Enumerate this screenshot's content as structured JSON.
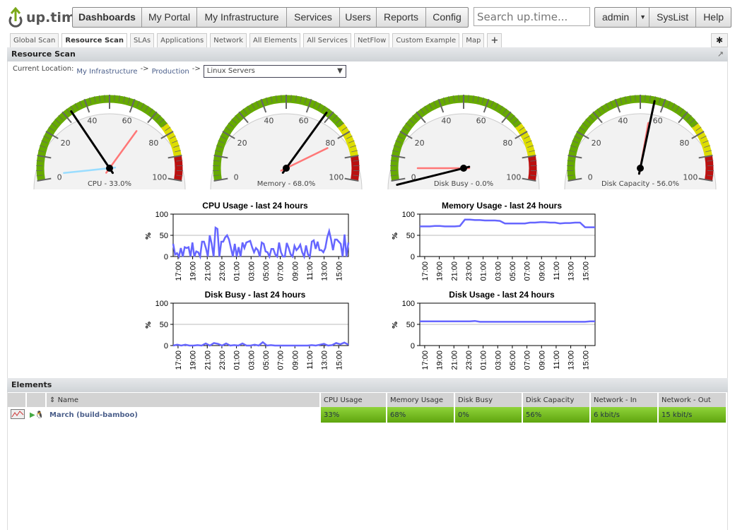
{
  "app": {
    "logo": "up.time"
  },
  "nav": {
    "items": [
      "Dashboards",
      "My Portal",
      "My Infrastructure",
      "Services",
      "Users",
      "Reports",
      "Config"
    ],
    "search_placeholder": "Search up.time...",
    "user": "admin",
    "syslist": "SysList",
    "help": "Help"
  },
  "tabs": [
    "Global Scan",
    "Resource Scan",
    "SLAs",
    "Applications",
    "Network",
    "All Elements",
    "All Services",
    "NetFlow",
    "Custom Example",
    "Map",
    "+"
  ],
  "panel": {
    "title": "Resource Scan",
    "location_label": "Current Location:",
    "crumbs": [
      "My Infrastructure",
      "Production"
    ],
    "sep": "->",
    "selected": "Linux Servers"
  },
  "gauges": [
    {
      "label": "CPU - 33.0%",
      "value": 33,
      "max": 68,
      "min": 2
    },
    {
      "label": "Memory - 68.0%",
      "value": 68,
      "max": 82,
      "min": null
    },
    {
      "label": "Disk Busy - 0.0%",
      "value": -2,
      "max": 5,
      "min": null
    },
    {
      "label": "Disk Capacity - 56.0%",
      "value": 56,
      "max": 55,
      "min": null
    }
  ],
  "gauge_ticks": [
    "0",
    "20",
    "40",
    "60",
    "80",
    "100"
  ],
  "chart_data": [
    {
      "type": "line",
      "title": "CPU Usage - last 24 hours",
      "ylabel": "%",
      "ylim": [
        0,
        100
      ],
      "yticks": [
        "0",
        "50",
        "100"
      ],
      "xticks": [
        "17:00",
        "19:00",
        "21:00",
        "23:00",
        "01:00",
        "03:00",
        "05:00",
        "07:00",
        "09:00",
        "11:00",
        "13:00",
        "15:00"
      ],
      "values": [
        30,
        5,
        8,
        0,
        20,
        0,
        22,
        20,
        22,
        0,
        33,
        0,
        12,
        10,
        0,
        35,
        35,
        20,
        0,
        50,
        30,
        0,
        68,
        65,
        0,
        35,
        35,
        45,
        50,
        40,
        20,
        0,
        30,
        0,
        22,
        0,
        33,
        20,
        33,
        35,
        37,
        22,
        10,
        20,
        15,
        0,
        33,
        30,
        12,
        10,
        0,
        18,
        18,
        5,
        0,
        33,
        10,
        0,
        0,
        32,
        20,
        5,
        0,
        25,
        15,
        20,
        28,
        10,
        0,
        26,
        5,
        0,
        35,
        38,
        18,
        35,
        15,
        15,
        10,
        20,
        45,
        60,
        40,
        15,
        40,
        40,
        35,
        30,
        0,
        52,
        0,
        33
      ]
    },
    {
      "type": "line",
      "title": "Memory Usage - last 24 hours",
      "ylabel": "%",
      "ylim": [
        0,
        100
      ],
      "yticks": [
        "0",
        "50",
        "100"
      ],
      "xticks": [
        "17:00",
        "19:00",
        "21:00",
        "23:00",
        "01:00",
        "03:00",
        "05:00",
        "07:00",
        "09:00",
        "11:00",
        "13:00",
        "15:00"
      ],
      "values": [
        71,
        71,
        71,
        72,
        72,
        71,
        71,
        71,
        72,
        87,
        87,
        86,
        86,
        85,
        85,
        85,
        84,
        78,
        78,
        78,
        78,
        78,
        80,
        80,
        81,
        81,
        80,
        80,
        78,
        79,
        79,
        80,
        80,
        69,
        69,
        69
      ]
    },
    {
      "type": "line",
      "title": "Disk Busy - last 24 hours",
      "ylabel": "%",
      "ylim": [
        0,
        100
      ],
      "yticks": [
        "0",
        "50",
        "100"
      ],
      "xticks": [
        "17:00",
        "19:00",
        "21:00",
        "23:00",
        "01:00",
        "03:00",
        "05:00",
        "07:00",
        "09:00",
        "11:00",
        "13:00",
        "15:00"
      ],
      "values": [
        0,
        2,
        0,
        2,
        0,
        0,
        1,
        0,
        5,
        0,
        6,
        4,
        0,
        5,
        0,
        1,
        0,
        5,
        0,
        0,
        2,
        0,
        8,
        0,
        1,
        0,
        0,
        0,
        0,
        0,
        0,
        0,
        0,
        0,
        1,
        0,
        2,
        4,
        0,
        1,
        6,
        3,
        7,
        2
      ]
    },
    {
      "type": "line",
      "title": "Disk Usage - last 24 hours",
      "ylabel": "%",
      "ylim": [
        0,
        100
      ],
      "yticks": [
        "0",
        "50",
        "100"
      ],
      "xticks": [
        "17:00",
        "19:00",
        "21:00",
        "23:00",
        "01:00",
        "03:00",
        "05:00",
        "07:00",
        "09:00",
        "11:00",
        "13:00",
        "15:00"
      ],
      "values": [
        57,
        57,
        57,
        57,
        57,
        57,
        57,
        57,
        57,
        57,
        57,
        58,
        56,
        56,
        56,
        56,
        56,
        56,
        56,
        56,
        56,
        56,
        56,
        56,
        56,
        56,
        56,
        56,
        56,
        56,
        56,
        56,
        56,
        56,
        57,
        57
      ]
    }
  ],
  "elements": {
    "title": "Elements",
    "columns": [
      "Name",
      "CPU Usage",
      "Memory Usage",
      "Disk Busy",
      "Disk Capacity",
      "Network - In",
      "Network - Out"
    ],
    "rows": [
      {
        "name": "March (build-bamboo)",
        "cpu": "33%",
        "mem": "68%",
        "disk": "0%",
        "cap": "56%",
        "net_in": "6 kbit/s",
        "net_out": "15 kbit/s"
      }
    ]
  },
  "colors": {
    "green": "#66aa00",
    "yellow": "#dddd00",
    "red": "#bb1111",
    "line": "#6666ff"
  }
}
